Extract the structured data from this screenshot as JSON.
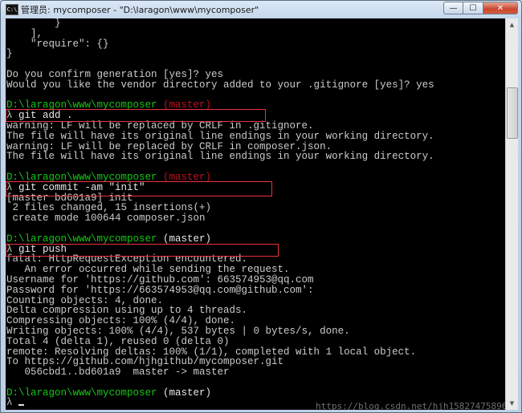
{
  "window": {
    "title": "管理员: mycomposer - \"D:\\laragon\\www\\mycomposer\"",
    "icon_label": "C:\\",
    "buttons": {
      "minimize": "—",
      "maximize": "☐",
      "close": "✕"
    }
  },
  "console": {
    "lines": [
      {
        "type": "plain",
        "text": "        }"
      },
      {
        "type": "plain",
        "text": "    ],"
      },
      {
        "type": "plain",
        "text": "    \"require\": {}"
      },
      {
        "type": "plain",
        "text": "}"
      },
      {
        "type": "plain",
        "text": ""
      },
      {
        "type": "plain",
        "text": "Do you confirm generation [yes]? yes"
      },
      {
        "type": "plain",
        "text": "Would you like the vendor directory added to your .gitignore [yes]? yes"
      },
      {
        "type": "plain",
        "text": ""
      },
      {
        "type": "prompt",
        "path": "D:\\laragon\\www\\mycomposer",
        "branch": "(master)",
        "branch_color": "red"
      },
      {
        "type": "command",
        "lambda": "λ",
        "text": " git add ."
      },
      {
        "type": "plain",
        "text": "warning: LF will be replaced by CRLF in .gitignore."
      },
      {
        "type": "plain",
        "text": "The file will have its original line endings in your working directory."
      },
      {
        "type": "plain",
        "text": "warning: LF will be replaced by CRLF in composer.json."
      },
      {
        "type": "plain",
        "text": "The file will have its original line endings in your working directory."
      },
      {
        "type": "plain",
        "text": ""
      },
      {
        "type": "prompt",
        "path": "D:\\laragon\\www\\mycomposer",
        "branch": "(master)",
        "branch_color": "red"
      },
      {
        "type": "command",
        "lambda": "λ",
        "text": " git commit -am \"init\""
      },
      {
        "type": "plain",
        "text": "[master bd601a9] init"
      },
      {
        "type": "plain",
        "text": " 2 files changed, 15 insertions(+)"
      },
      {
        "type": "plain",
        "text": " create mode 100644 composer.json"
      },
      {
        "type": "plain",
        "text": ""
      },
      {
        "type": "prompt",
        "path": "D:\\laragon\\www\\mycomposer",
        "branch": "(master)",
        "branch_color": "white"
      },
      {
        "type": "command",
        "lambda": "λ",
        "text": " git push"
      },
      {
        "type": "plain",
        "text": "fatal: HttpRequestException encountered."
      },
      {
        "type": "plain",
        "text": "   An error occurred while sending the request."
      },
      {
        "type": "plain",
        "text": "Username for 'https://github.com': 663574953@qq.com"
      },
      {
        "type": "plain",
        "text": "Password for 'https://663574953@qq.com@github.com':"
      },
      {
        "type": "plain",
        "text": "Counting objects: 4, done."
      },
      {
        "type": "plain",
        "text": "Delta compression using up to 4 threads."
      },
      {
        "type": "plain",
        "text": "Compressing objects: 100% (4/4), done."
      },
      {
        "type": "plain",
        "text": "Writing objects: 100% (4/4), 537 bytes | 0 bytes/s, done."
      },
      {
        "type": "plain",
        "text": "Total 4 (delta 1), reused 0 (delta 0)"
      },
      {
        "type": "plain",
        "text": "remote: Resolving deltas: 100% (1/1), completed with 1 local object."
      },
      {
        "type": "plain",
        "text": "To https://github.com/hjhgithub/mycomposer.git"
      },
      {
        "type": "plain",
        "text": "   056cbd1..bd601a9  master -> master"
      },
      {
        "type": "plain",
        "text": ""
      },
      {
        "type": "prompt",
        "path": "D:\\laragon\\www\\mycomposer",
        "branch": "(master)",
        "branch_color": "white"
      },
      {
        "type": "cursor",
        "lambda": "λ"
      }
    ]
  },
  "watermark": "https://blog.csdn.net/hjh15827475896",
  "colors": {
    "path_green": "#13c813",
    "branch_red": "#c80e1c",
    "highlight_box": "#e8333b",
    "console_bg": "#000000"
  }
}
